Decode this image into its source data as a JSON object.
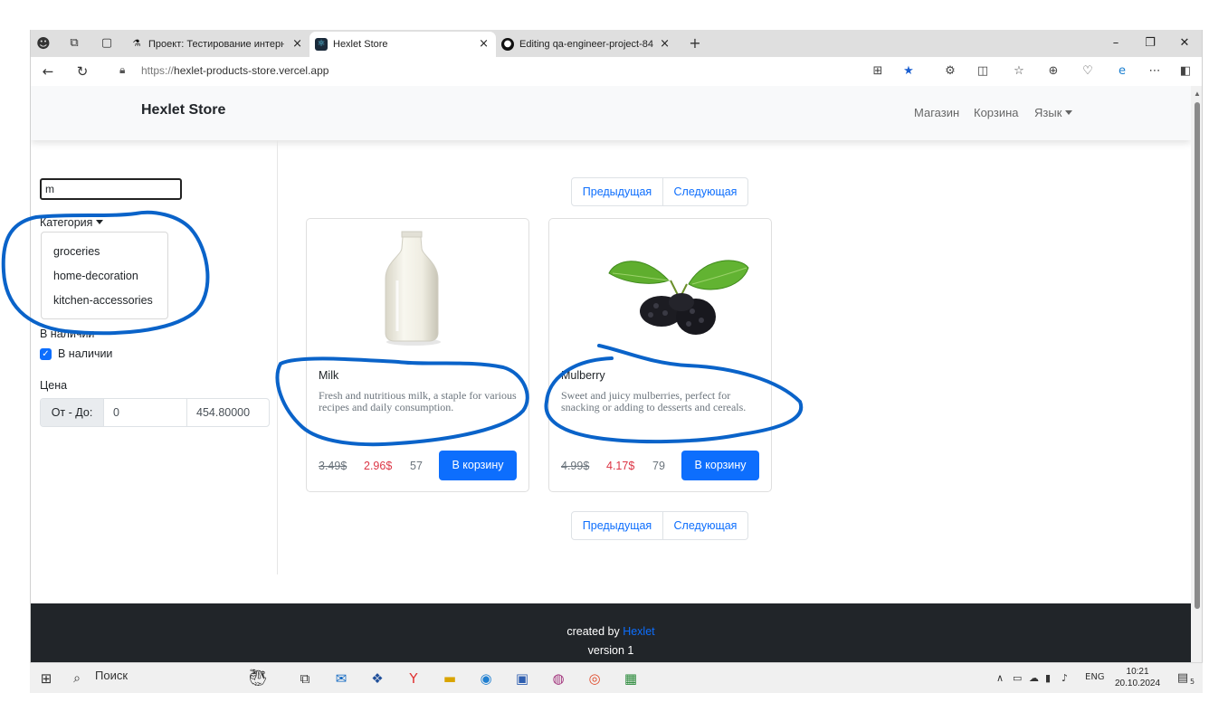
{
  "browser": {
    "tabs": [
      {
        "title": "Проект: Тестирование интернет",
        "favicon": "hexlet-project-icon"
      },
      {
        "title": "Hexlet Store",
        "favicon": "react-icon"
      },
      {
        "title": "Editing qa-engineer-project-84/te",
        "favicon": "github-icon"
      }
    ],
    "tab_close": "×",
    "new_tab": "+",
    "address": {
      "protocol": "https://",
      "host": "hexlet-products-store.vercel.app"
    }
  },
  "header": {
    "brand": "Hexlet Store",
    "nav": {
      "shop": "Магазин",
      "cart": "Корзина",
      "language": "Язык"
    }
  },
  "filters": {
    "search_value": "m",
    "category_label": "Категория",
    "categories": [
      "groceries",
      "home-decoration",
      "kitchen-accessories"
    ],
    "availability_label": "В наличии",
    "availability_checkbox": "В наличии",
    "availability_checked": true,
    "price_label": "Цена",
    "price_range_label": "От - До:",
    "price_from": "0",
    "price_to": "454.80000"
  },
  "pagination": {
    "prev": "Предыдущая",
    "next": "Следующая"
  },
  "products": [
    {
      "name": "Milk",
      "description": "Fresh and nutritious milk, a staple for various recipes and daily consumption.",
      "old_price": "3.49$",
      "price": "2.96$",
      "stock": "57",
      "button": "В корзину"
    },
    {
      "name": "Mulberry",
      "description": "Sweet and juicy mulberries, perfect for snacking or adding to desserts and cereals.",
      "old_price": "4.99$",
      "price": "4.17$",
      "stock": "79",
      "button": "В корзину"
    }
  ],
  "footer": {
    "created_by": "created by",
    "author": "Hexlet",
    "version": "version 1"
  },
  "taskbar": {
    "search_label": "Поиск",
    "language": "ENG",
    "time": "10:21",
    "date": "20.10.2024",
    "notifications": "5"
  },
  "colors": {
    "accent": "#0d6efd",
    "sale_price": "#dc3545",
    "footer_bg": "#212529",
    "annotation": "#0a63c9"
  }
}
